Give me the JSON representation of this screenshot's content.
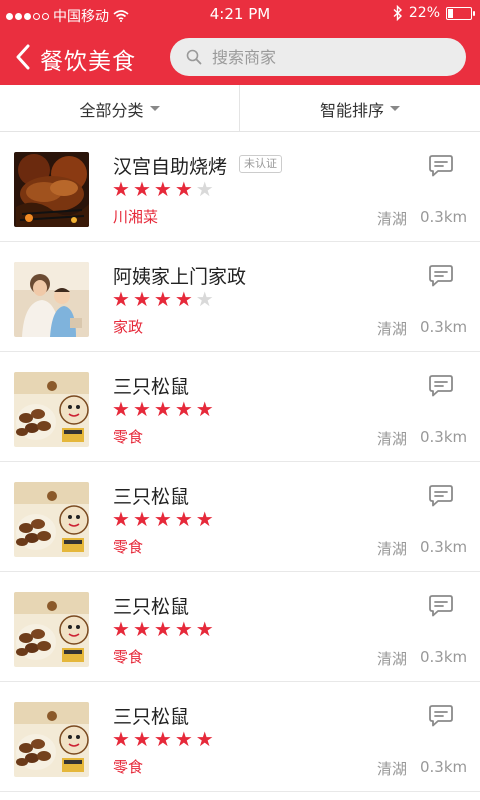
{
  "status": {
    "carrier": "中国移动",
    "time": "4:21 PM",
    "battery": "22%",
    "battery_level": 0.22
  },
  "nav": {
    "title": "餐饮美食",
    "search_placeholder": "搜索商家"
  },
  "filters": {
    "category": "全部分类",
    "sort": "智能排序"
  },
  "colors": {
    "brand": "#ea2f3f",
    "star_on": "#e6293a",
    "star_off": "#d9d9d9"
  },
  "items": [
    {
      "name": "汉宫自助烧烤",
      "badge": "未认证",
      "rating": 4,
      "category": "川湘菜",
      "district": "清湖",
      "distance": "0.3km",
      "image": "bbq"
    },
    {
      "name": "阿姨家上门家政",
      "rating": 4,
      "category": "家政",
      "district": "清湖",
      "distance": "0.3km",
      "image": "housekeeping"
    },
    {
      "name": "三只松鼠",
      "rating": 5,
      "category": "零食",
      "district": "清湖",
      "distance": "0.3km",
      "image": "nuts"
    },
    {
      "name": "三只松鼠",
      "rating": 5,
      "category": "零食",
      "district": "清湖",
      "distance": "0.3km",
      "image": "nuts"
    },
    {
      "name": "三只松鼠",
      "rating": 5,
      "category": "零食",
      "district": "清湖",
      "distance": "0.3km",
      "image": "nuts"
    },
    {
      "name": "三只松鼠",
      "rating": 5,
      "category": "零食",
      "district": "清湖",
      "distance": "0.3km",
      "image": "nuts"
    }
  ]
}
